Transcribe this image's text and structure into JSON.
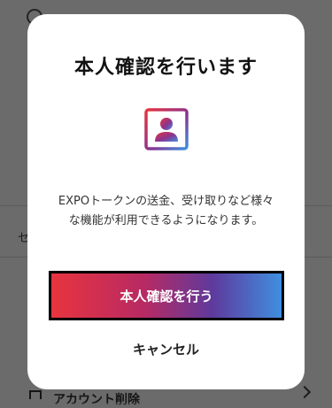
{
  "background": {
    "left_fragment": "セ",
    "bottom_row_label": "アカウント削除"
  },
  "modal": {
    "title": "本人確認を行います",
    "icon": "id-badge-icon",
    "description_line1": "EXPOトークンの送金、受け取りなど様々",
    "description_line2": "な機能が利用できるようになります。",
    "primary_button": "本人確認を行う",
    "cancel_button": "キャンセル"
  },
  "colors": {
    "gradient_start": "#e8343e",
    "gradient_mid": "#5e3a9d",
    "gradient_end": "#3f8fe0"
  }
}
